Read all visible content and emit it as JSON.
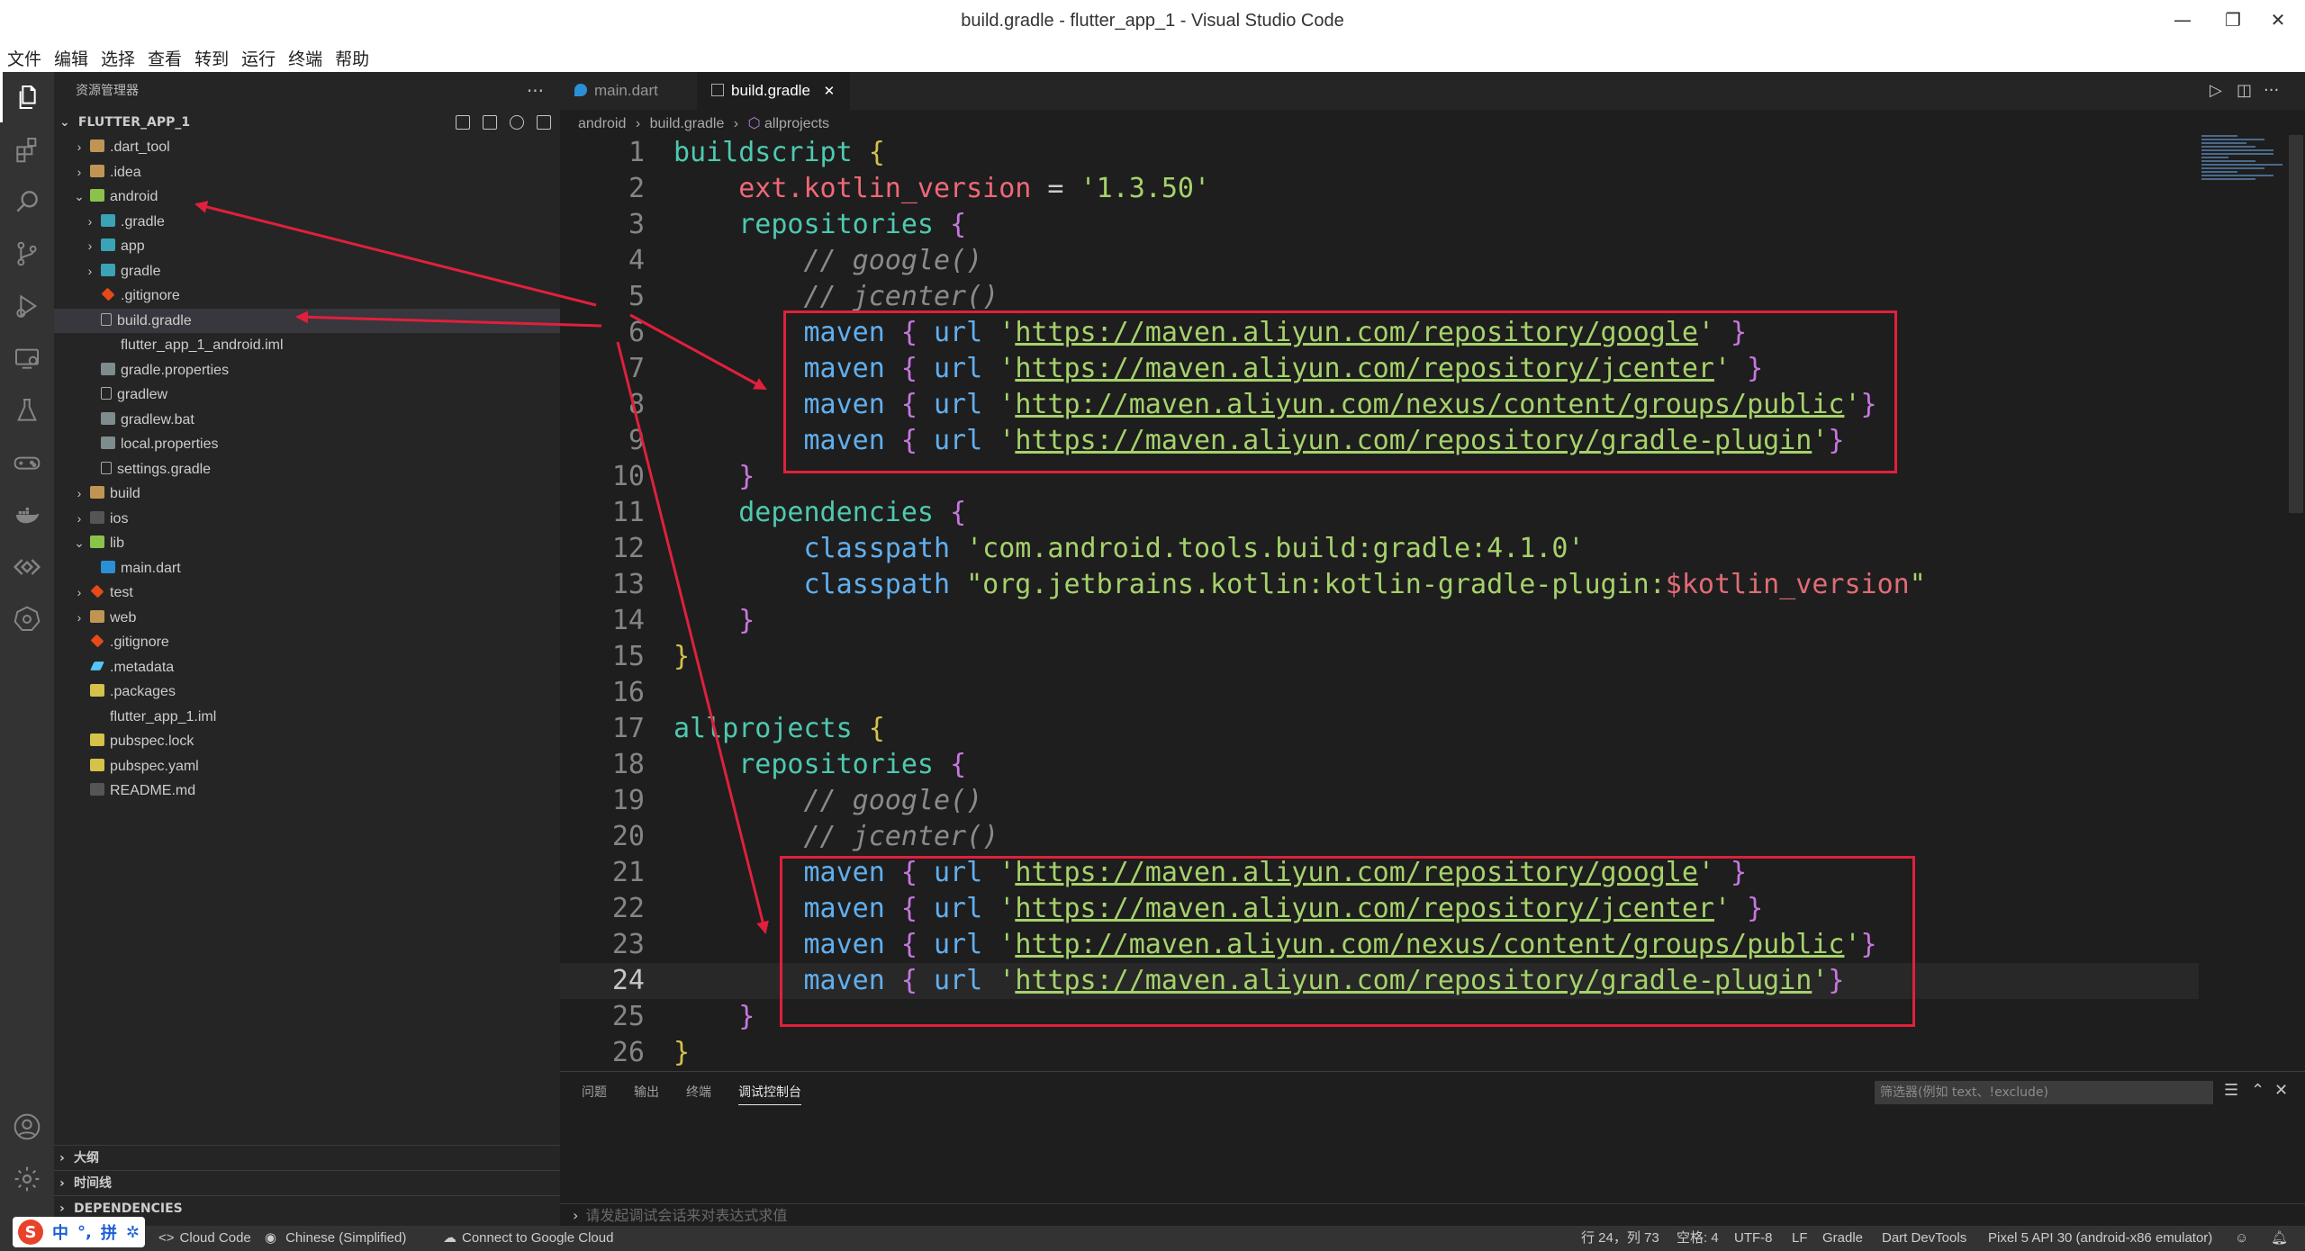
{
  "window": {
    "title": "build.gradle - flutter_app_1 - Visual Studio Code",
    "minimize": "—",
    "maximize": "❐",
    "close": "✕"
  },
  "menu": [
    "文件",
    "编辑",
    "选择",
    "查看",
    "转到",
    "运行",
    "终端",
    "帮助"
  ],
  "sidebar": {
    "header": "资源管理器",
    "more": "···",
    "project": "FLUTTER_APP_1",
    "tree": [
      {
        "label": ".dart_tool",
        "depth": 0,
        "chevron": "›",
        "icon": "folder"
      },
      {
        "label": ".idea",
        "depth": 0,
        "chevron": "›",
        "icon": "folder"
      },
      {
        "label": "android",
        "depth": 0,
        "chevron": "⌄",
        "icon": "folder-open"
      },
      {
        "label": ".gradle",
        "depth": 1,
        "chevron": "›",
        "icon": "f-gradle"
      },
      {
        "label": "app",
        "depth": 1,
        "chevron": "›",
        "icon": "f-gradle"
      },
      {
        "label": "gradle",
        "depth": 1,
        "chevron": "›",
        "icon": "f-gradle"
      },
      {
        "label": ".gitignore",
        "depth": 1,
        "chevron": "",
        "icon": "f-git"
      },
      {
        "label": "build.gradle",
        "depth": 1,
        "chevron": "",
        "icon": "f-file",
        "selected": true
      },
      {
        "label": "flutter_app_1_android.iml",
        "depth": 1,
        "chevron": "",
        "icon": "f-xml"
      },
      {
        "label": "gradle.properties",
        "depth": 1,
        "chevron": "",
        "icon": "f-gear"
      },
      {
        "label": "gradlew",
        "depth": 1,
        "chevron": "",
        "icon": "f-file"
      },
      {
        "label": "gradlew.bat",
        "depth": 1,
        "chevron": "",
        "icon": "f-gear"
      },
      {
        "label": "local.properties",
        "depth": 1,
        "chevron": "",
        "icon": "f-gear"
      },
      {
        "label": "settings.gradle",
        "depth": 1,
        "chevron": "",
        "icon": "f-file"
      },
      {
        "label": "build",
        "depth": 0,
        "chevron": "›",
        "icon": "folder"
      },
      {
        "label": "ios",
        "depth": 0,
        "chevron": "›",
        "icon": "f-md"
      },
      {
        "label": "lib",
        "depth": 0,
        "chevron": "⌄",
        "icon": "folder-open"
      },
      {
        "label": "main.dart",
        "depth": 1,
        "chevron": "",
        "icon": "f-dart"
      },
      {
        "label": "test",
        "depth": 0,
        "chevron": "›",
        "icon": "f-git"
      },
      {
        "label": "web",
        "depth": 0,
        "chevron": "›",
        "icon": "folder"
      },
      {
        "label": ".gitignore",
        "depth": 0,
        "chevron": "",
        "icon": "f-git"
      },
      {
        "label": ".metadata",
        "depth": 0,
        "chevron": "",
        "icon": "f-flutter"
      },
      {
        "label": ".packages",
        "depth": 0,
        "chevron": "",
        "icon": "f-yaml"
      },
      {
        "label": "flutter_app_1.iml",
        "depth": 0,
        "chevron": "",
        "icon": "f-xml"
      },
      {
        "label": "pubspec.lock",
        "depth": 0,
        "chevron": "",
        "icon": "f-yaml"
      },
      {
        "label": "pubspec.yaml",
        "depth": 0,
        "chevron": "",
        "icon": "f-yaml"
      },
      {
        "label": "README.md",
        "depth": 0,
        "chevron": "",
        "icon": "f-md"
      }
    ],
    "sections": [
      "大纲",
      "时间线",
      "DEPENDENCIES"
    ]
  },
  "tabs": [
    {
      "label": "main.dart",
      "active": false
    },
    {
      "label": "build.gradle",
      "active": true,
      "close": "✕"
    }
  ],
  "editor_actions": [
    "▷",
    "◫",
    "···"
  ],
  "breadcrumb": [
    "android",
    "build.gradle",
    "allprojects"
  ],
  "panel": {
    "tabs": [
      "问题",
      "输出",
      "终端",
      "调试控制台"
    ],
    "filter_placeholder": "筛选器(例如 text、!exclude)",
    "repl_placeholder": "请发起调试会话来对表达式求值"
  },
  "statusbar": {
    "cloud_code": "Cloud Code",
    "language": "Chinese (Simplified)",
    "connect": "Connect to Google Cloud",
    "position": "行 24，列 73",
    "spaces": "空格: 4",
    "encoding": "UTF-8",
    "eol": "LF",
    "mode": "Gradle",
    "devtools": "Dart DevTools",
    "device": "Pixel 5 API 30 (android-x86 emulator)"
  },
  "ime": {
    "logo": "S",
    "items": [
      "中",
      "°,",
      "拼",
      "✲"
    ]
  },
  "colors": {
    "annotation_red": "#e0203c",
    "accent": "#007acc"
  }
}
